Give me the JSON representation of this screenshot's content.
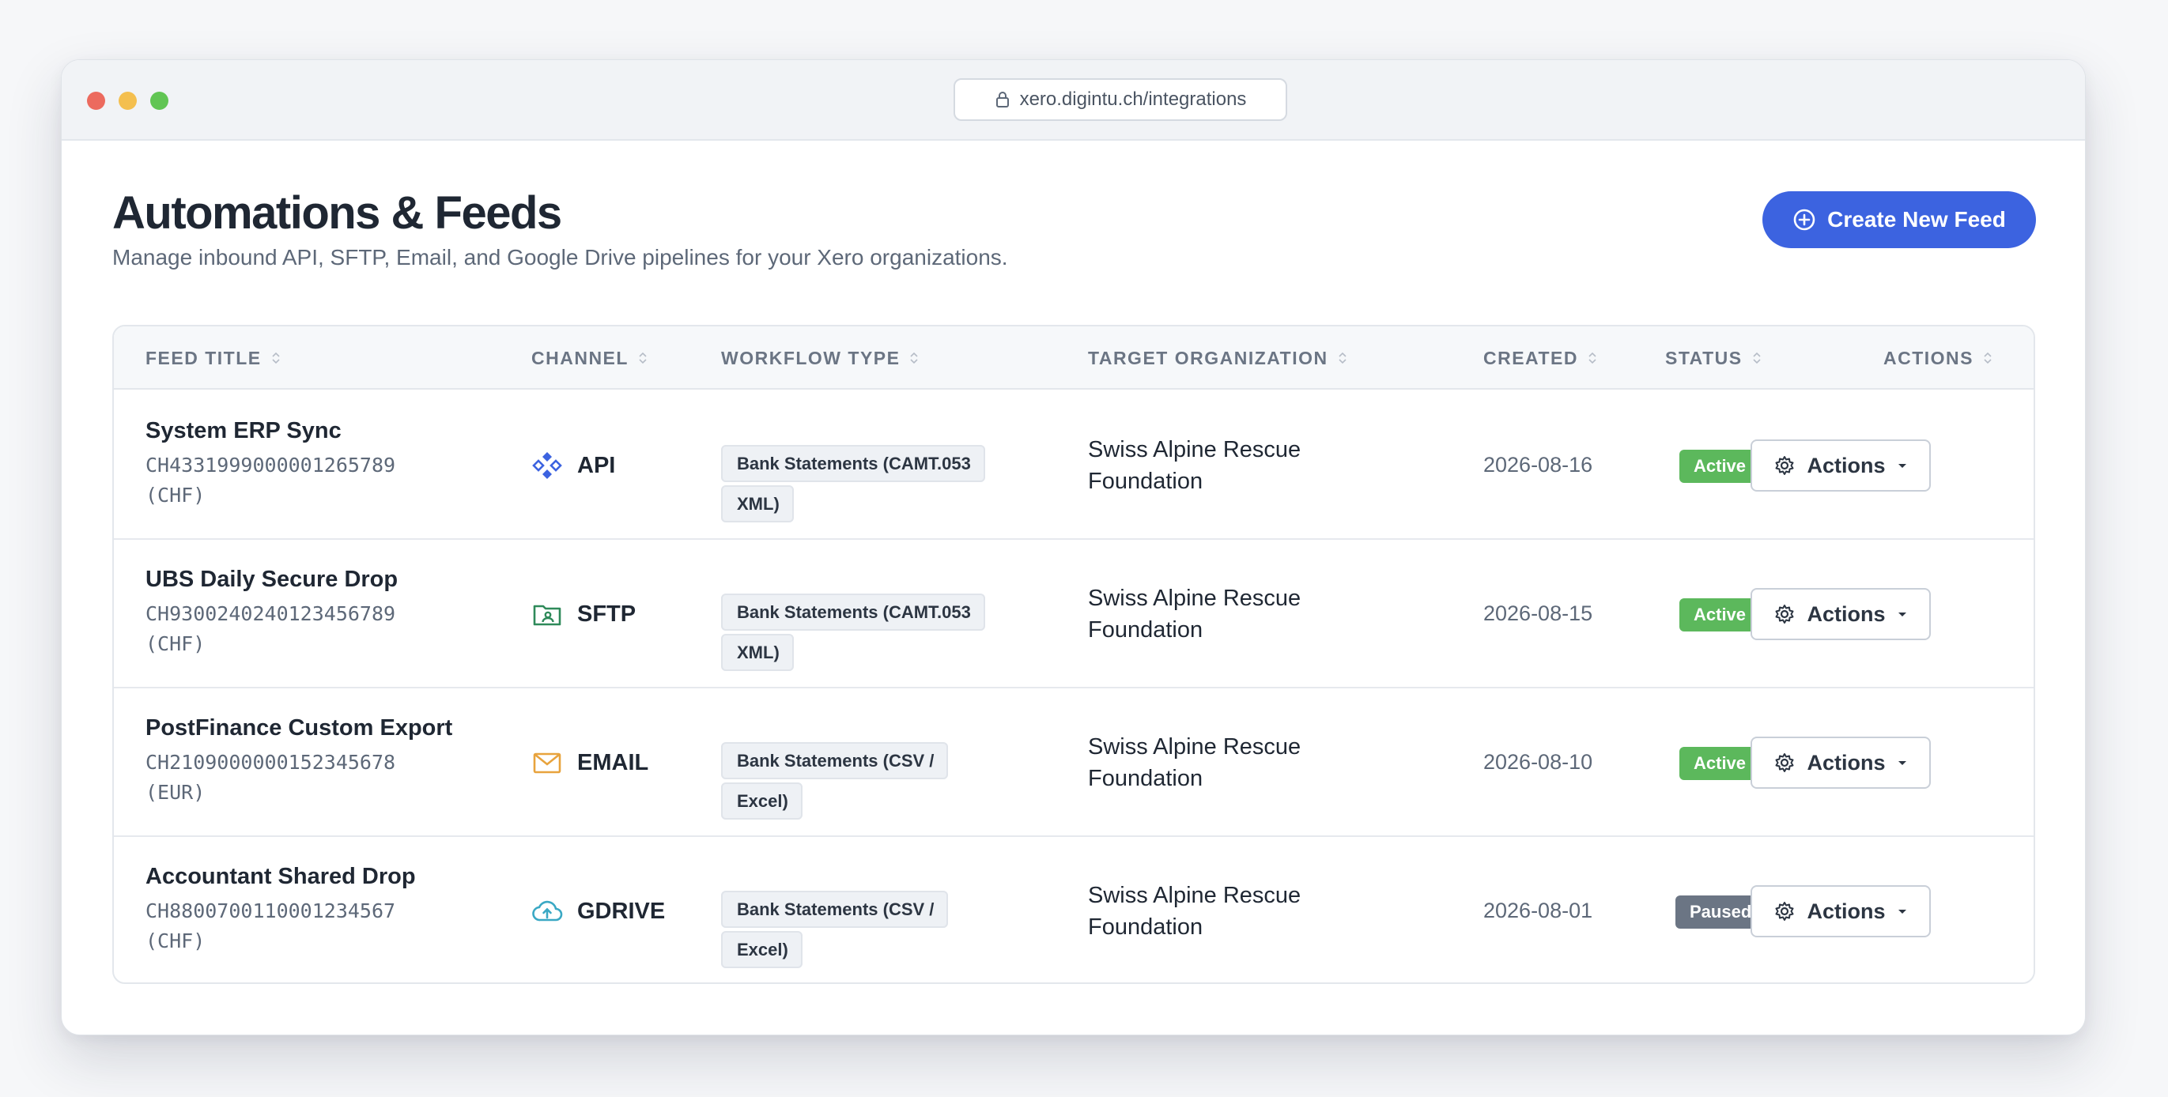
{
  "browser": {
    "url": "xero.digintu.ch/integrations"
  },
  "header": {
    "title": "Automations & Feeds",
    "subtitle": "Manage inbound API, SFTP, Email, and Google Drive pipelines for your Xero organizations.",
    "create_button_label": "Create New Feed"
  },
  "table": {
    "columns": [
      {
        "label": "FEED TITLE"
      },
      {
        "label": "CHANNEL"
      },
      {
        "label": "WORKFLOW TYPE"
      },
      {
        "label": "TARGET ORGANIZATION"
      },
      {
        "label": "CREATED"
      },
      {
        "label": "STATUS"
      },
      {
        "label": "ACTIONS"
      }
    ],
    "rows": [
      {
        "title": "System ERP Sync",
        "account": "CH4331999000001265789",
        "currency": "(CHF)",
        "channel": "API",
        "channel_icon": "api-icon",
        "channel_color": "#3c63e0",
        "workflow": "Bank Statements (CAMT.053 XML)",
        "organization": "Swiss Alpine Rescue Foundation",
        "created": "2026-08-16",
        "status": "Active",
        "status_color": "#5cb85c",
        "actions_label": "Actions"
      },
      {
        "title": "UBS Daily Secure Drop",
        "account": "CH9300240240123456789",
        "currency": "(CHF)",
        "channel": "SFTP",
        "channel_icon": "folder-user-icon",
        "channel_color": "#2f8a5a",
        "workflow": "Bank Statements (CAMT.053 XML)",
        "organization": "Swiss Alpine Rescue Foundation",
        "created": "2026-08-15",
        "status": "Active",
        "status_color": "#5cb85c",
        "actions_label": "Actions"
      },
      {
        "title": "PostFinance Custom Export",
        "account": "CH2109000000152345678",
        "currency": "(EUR)",
        "channel": "EMAIL",
        "channel_icon": "envelope-icon",
        "channel_color": "#e8a33d",
        "workflow": "Bank Statements (CSV / Excel)",
        "organization": "Swiss Alpine Rescue Foundation",
        "created": "2026-08-10",
        "status": "Active",
        "status_color": "#5cb85c",
        "actions_label": "Actions"
      },
      {
        "title": "Accountant Shared Drop",
        "account": "CH8800700110001234567",
        "currency": "(CHF)",
        "channel": "GDRIVE",
        "channel_icon": "cloud-upload-icon",
        "channel_color": "#3aa8c4",
        "workflow": "Bank Statements (CSV / Excel)",
        "organization": "Swiss Alpine Rescue Foundation",
        "created": "2026-08-01",
        "status": "Paused",
        "status_color": "#6b7584",
        "actions_label": "Actions"
      }
    ]
  }
}
